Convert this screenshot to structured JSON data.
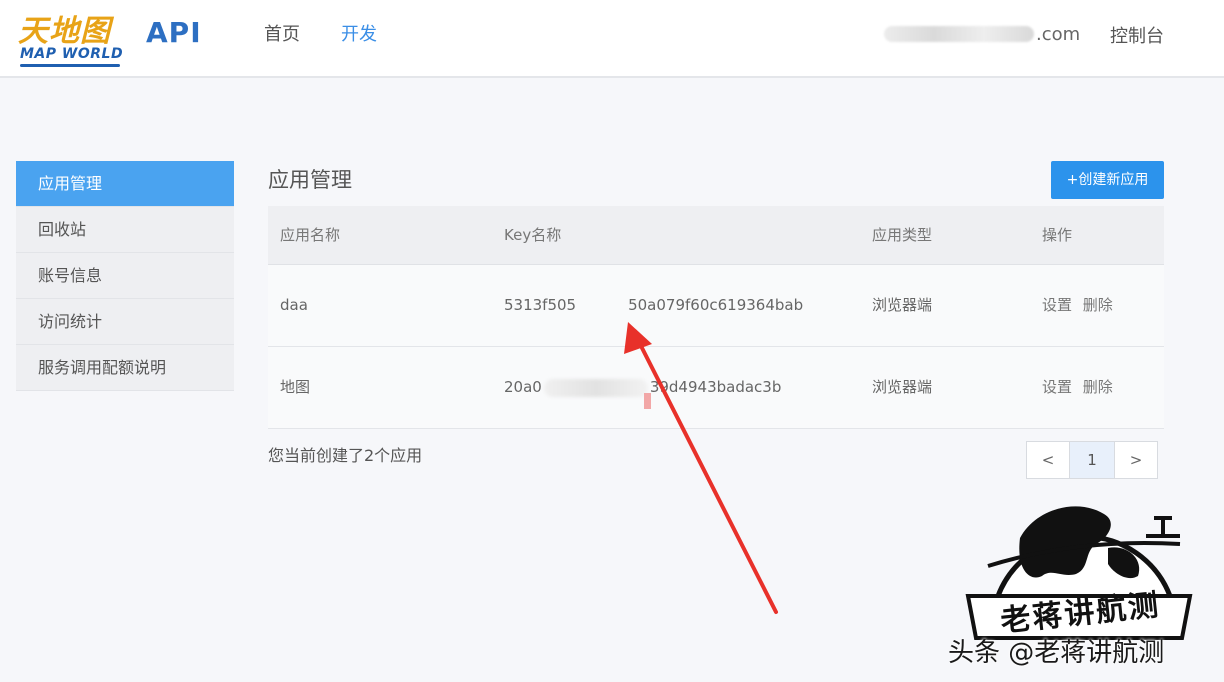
{
  "header": {
    "logo_cn": "天地图",
    "logo_en": "MAP WORLD",
    "api_label": "API",
    "nav": [
      {
        "label": "首页"
      },
      {
        "label": "开发"
      }
    ],
    "user_domain": ".com",
    "console": "控制台"
  },
  "sidebar": {
    "items": [
      {
        "label": "应用管理",
        "active": true
      },
      {
        "label": "回收站"
      },
      {
        "label": "账号信息"
      },
      {
        "label": "访问统计"
      },
      {
        "label": "服务调用配额说明"
      }
    ]
  },
  "main": {
    "title": "应用管理",
    "create_button": "+创建新应用",
    "table": {
      "columns": [
        "应用名称",
        "Key名称",
        "应用类型",
        "操作"
      ],
      "rows": [
        {
          "name": "daa",
          "key": "5313f505",
          "key_tail": "50a079f60c619364bab",
          "type": "浏览器端",
          "actions": [
            "设置",
            "删除"
          ]
        },
        {
          "name": "地图",
          "key": "20a0",
          "key_tail": "39d4943badac3b",
          "type": "浏览器端",
          "actions": [
            "设置",
            "删除"
          ]
        }
      ]
    },
    "summary": "您当前创建了2个应用",
    "pagination": {
      "prev": "<",
      "current": "1",
      "next": ">"
    }
  },
  "overlay": {
    "arrow_color": "#e8312a",
    "badge_text": "老蒋讲航测",
    "watermark": "头条 @老蒋讲航测"
  }
}
